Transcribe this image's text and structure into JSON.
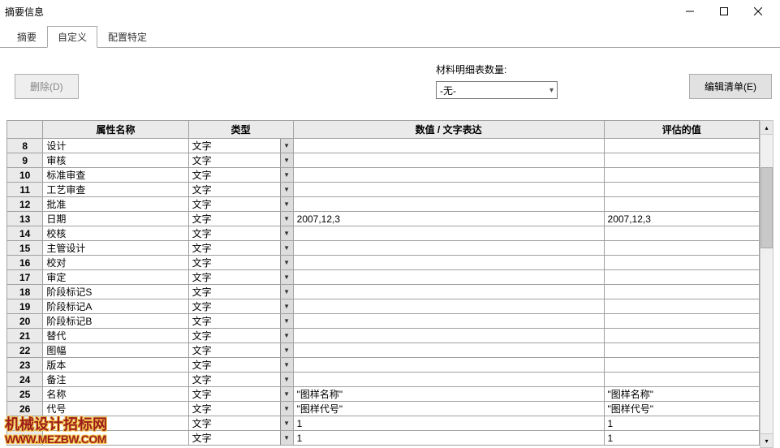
{
  "window": {
    "title": "摘要信息"
  },
  "tabs": {
    "t0": "摘要",
    "t1": "自定义",
    "t2": "配置特定",
    "active": 1
  },
  "toolbar": {
    "delete_label": "删除(D)",
    "bom_label": "材料明细表数量:",
    "bom_value": "-无-",
    "edit_list_label": "编辑清单(E)"
  },
  "headers": {
    "name": "属性名称",
    "type": "类型",
    "value": "数值 / 文字表达",
    "eval": "评估的值"
  },
  "type_text": "文字",
  "rows": [
    {
      "n": "8",
      "name": "设计",
      "val": "",
      "eval": ""
    },
    {
      "n": "9",
      "name": "审核",
      "val": "",
      "eval": ""
    },
    {
      "n": "10",
      "name": "标准审查",
      "val": "",
      "eval": ""
    },
    {
      "n": "11",
      "name": "工艺审查",
      "val": "",
      "eval": ""
    },
    {
      "n": "12",
      "name": "批准",
      "val": "",
      "eval": ""
    },
    {
      "n": "13",
      "name": "日期",
      "val": "2007,12,3",
      "eval": "2007,12,3"
    },
    {
      "n": "14",
      "name": "校核",
      "val": "",
      "eval": ""
    },
    {
      "n": "15",
      "name": "主管设计",
      "val": "",
      "eval": ""
    },
    {
      "n": "16",
      "name": "校对",
      "val": "",
      "eval": ""
    },
    {
      "n": "17",
      "name": "审定",
      "val": "",
      "eval": ""
    },
    {
      "n": "18",
      "name": "阶段标记S",
      "val": "",
      "eval": ""
    },
    {
      "n": "19",
      "name": "阶段标记A",
      "val": "",
      "eval": ""
    },
    {
      "n": "20",
      "name": "阶段标记B",
      "val": "",
      "eval": ""
    },
    {
      "n": "21",
      "name": "替代",
      "val": "",
      "eval": ""
    },
    {
      "n": "22",
      "name": "图幅",
      "val": "",
      "eval": ""
    },
    {
      "n": "23",
      "name": "版本",
      "val": "",
      "eval": ""
    },
    {
      "n": "24",
      "name": "备注",
      "val": "",
      "eval": ""
    },
    {
      "n": "25",
      "name": "名称",
      "val": "\"图样名称\"",
      "eval": "\"图样名称\""
    },
    {
      "n": "26",
      "name": "代号",
      "val": "\"图样代号\"",
      "eval": "\"图样代号\""
    },
    {
      "n": "27",
      "name": "",
      "val": "1",
      "eval": "1"
    },
    {
      "n": "28",
      "name": "",
      "val": "1",
      "eval": "1"
    }
  ],
  "watermark": {
    "l1": "机械设计招标网",
    "l2": "WWW.MEZBW.COM"
  }
}
